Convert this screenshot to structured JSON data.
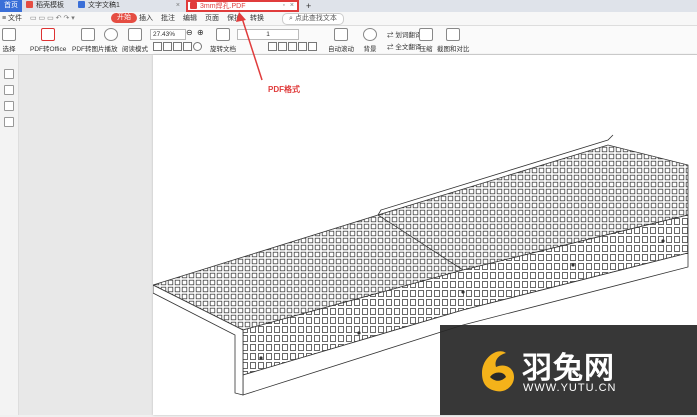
{
  "tabs": [
    {
      "label": "首页"
    },
    {
      "label": "稻壳模板"
    },
    {
      "label": "文字文稿1"
    },
    {
      "label": "3mm焊孔.PDF"
    }
  ],
  "menu": {
    "file": "文件",
    "items": [
      "开始",
      "插入",
      "批注",
      "编辑",
      "页面",
      "保护",
      "转换"
    ],
    "search": "点此查找文本"
  },
  "toolbar": {
    "select": "选择",
    "pdf_to_office": "PDF转Office",
    "pdf_to_image": "PDF转图片",
    "play": "播放",
    "read_mode": "阅读模式",
    "zoom": "27.43%",
    "page": "1",
    "rotate": "旋转文档",
    "auto_scroll": "自动滚动",
    "background": "背景",
    "word_translate": "划词翻译",
    "full_translate": "全文翻译",
    "compress": "压缩",
    "screenshot_compare": "截图和对比"
  },
  "annotation": "PDF格式",
  "watermark": {
    "title": "羽兔网",
    "url": "WWW.YUTU.CN"
  },
  "colors": {
    "accent": "#e03c3c",
    "tab_active_bg": "#3a6fd8"
  }
}
